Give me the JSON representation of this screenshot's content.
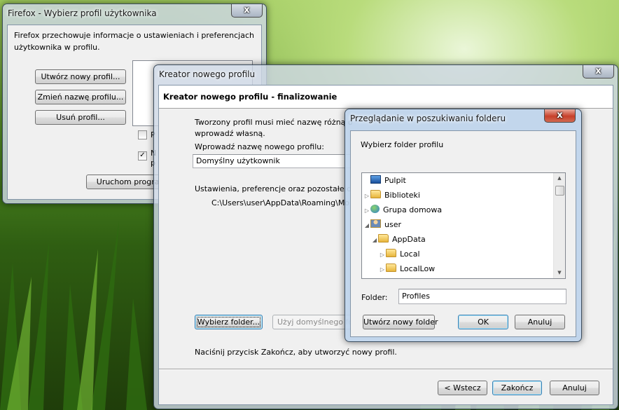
{
  "desktop": {
    "wallpaper": "green-grass"
  },
  "profile_manager": {
    "title": "Firefox - Wybierz profil użytkownika",
    "close_glyph": "x",
    "description_line1": "Firefox przechowuje informacje o ustawieniach i preferencjach",
    "description_line2": "użytkownika w profilu.",
    "create_button": "Utwórz nowy profil...",
    "rename_button": "Zmień nazwę profilu...",
    "delete_button": "Usuń profil...",
    "checkbox1_label": "P",
    "checkbox2_label_line1": "N",
    "checkbox2_label_line2": "p",
    "checkbox2_mark": "✓",
    "start_button": "Uruchom program"
  },
  "wizard": {
    "title": "Kreator nowego profilu",
    "close_glyph": "x",
    "header": "Kreator nowego profilu - finalizowanie",
    "intro_line1": "Tworzony profil musi mieć nazwę różną o",
    "intro_line2": "wprowadź własną.",
    "name_label": "Wprowadź nazwę nowego profilu:",
    "name_value": "Domyślny użytkownik",
    "settings_text": "Ustawienia, preferencje oraz pozostałe da",
    "path_text": "C:\\Users\\user\\AppData\\Roaming\\Mo",
    "choose_folder_button": "Wybierz folder...",
    "use_default_button": "Użyj domyślnego fo",
    "finish_hint": "Naciśnij przycisk Zakończ, aby utworzyć nowy profil.",
    "back_button": "< Wstecz",
    "finish_button": "Zakończ",
    "cancel_button": "Anuluj"
  },
  "browse_dialog": {
    "title": "Przeglądanie w poszukiwaniu folderu",
    "close_glyph": "x",
    "prompt": "Wybierz folder profilu",
    "tree": [
      {
        "label": "Pulpit",
        "icon": "desktop-icon",
        "expander": ""
      },
      {
        "label": "Biblioteki",
        "icon": "libraries-icon",
        "expander": "▷"
      },
      {
        "label": "Grupa domowa",
        "icon": "homegroup-icon",
        "expander": "▷"
      },
      {
        "label": "user",
        "icon": "user-folder-icon",
        "expander": "◢"
      },
      {
        "label": "AppData",
        "icon": "folder-icon",
        "expander": "◢"
      },
      {
        "label": "Local",
        "icon": "folder-icon",
        "expander": "▷"
      },
      {
        "label": "LocalLow",
        "icon": "folder-icon",
        "expander": "▷"
      }
    ],
    "scroll_up_glyph": "▲",
    "scroll_down_glyph": "▼",
    "folder_label": "Folder:",
    "folder_value": "Profiles",
    "new_folder_button": "Utwórz nowy folder",
    "ok_button": "OK",
    "cancel_button": "Anuluj"
  }
}
